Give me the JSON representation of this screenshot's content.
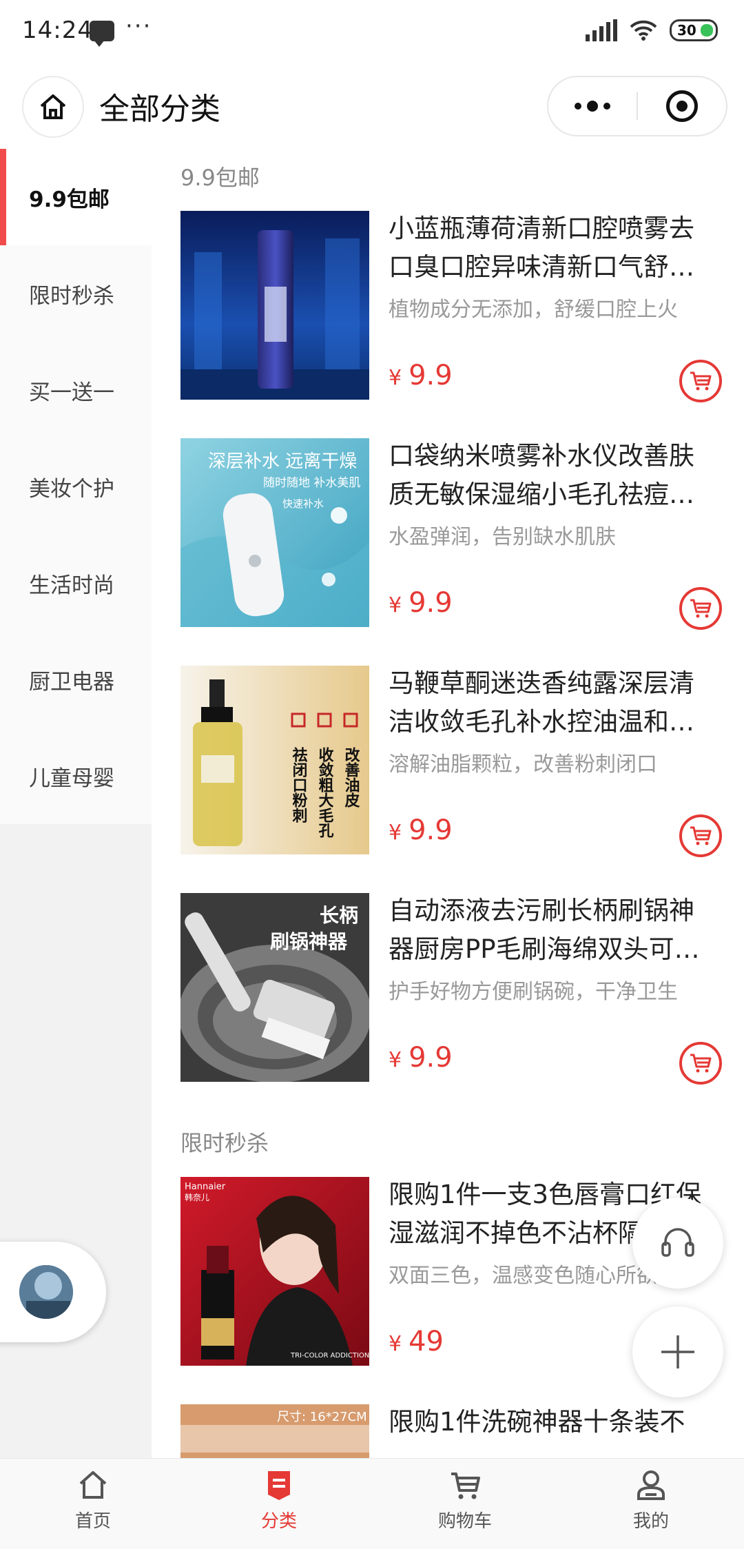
{
  "status_bar": {
    "time": "14:24",
    "dots": "···",
    "battery": "30"
  },
  "header": {
    "title": "全部分类"
  },
  "sidebar": {
    "items": [
      {
        "label": "9.9包邮",
        "active": true
      },
      {
        "label": "限时秒杀",
        "active": false
      },
      {
        "label": "买一送一",
        "active": false
      },
      {
        "label": "美妆个护",
        "active": false
      },
      {
        "label": "生活时尚",
        "active": false
      },
      {
        "label": "厨卫电器",
        "active": false
      },
      {
        "label": "儿童母婴",
        "active": false
      }
    ]
  },
  "sections": [
    {
      "title": "9.9包邮",
      "products": [
        {
          "title": "小蓝瓶薄荷清新口腔喷雾去口臭口腔异味清新口气舒…",
          "desc": "植物成分无添加，舒缓口腔上火",
          "currency": "¥",
          "price": "9.9"
        },
        {
          "title": "口袋纳米喷雾补水仪改善肤质无敏保湿缩小毛孔祛痘…",
          "desc": "水盈弹润，告别缺水肌肤",
          "currency": "¥",
          "price": "9.9"
        },
        {
          "title": "马鞭草酮迷迭香纯露深层清洁收敛毛孔补水控油温和…",
          "desc": "溶解油脂颗粒，改善粉刺闭口",
          "currency": "¥",
          "price": "9.9"
        },
        {
          "title": "自动添液去污刷长柄刷锅神器厨房PP毛刷海绵双头可…",
          "desc": "护手好物方便刷锅碗，干净卫生",
          "currency": "¥",
          "price": "9.9"
        }
      ]
    },
    {
      "title": "限时秒杀",
      "products": [
        {
          "title": "限购1件一支3色唇膏口红保湿滋润不掉色不沾杯隔…",
          "desc": "双面三色，温感变色随心所欲",
          "currency": "¥",
          "price": "49"
        },
        {
          "title": "限购1件洗碗神器十条装不",
          "desc": "",
          "currency": "¥",
          "price": ""
        }
      ]
    }
  ],
  "image_text": {
    "p2_line1": "深层补水 远离干燥",
    "p2_line2": "随时随地 补水美肌",
    "p2_badge": "快速补水",
    "p3_col1": "改善油皮",
    "p3_col2": "收敛粗大毛孔",
    "p3_col3": "祛闭口粉刺",
    "p4_line1": "长柄",
    "p4_line2": "刷锅神器",
    "p5_brand": "Hannaier",
    "p5_brand_cn": "韩奈儿",
    "p5_tag": "TRI-COLOR ADDICTION",
    "p6_size": "尺寸: 16*27CM"
  },
  "tabbar": {
    "items": [
      {
        "label": "首页",
        "icon": "home-icon",
        "active": false
      },
      {
        "label": "分类",
        "icon": "category-icon",
        "active": true
      },
      {
        "label": "购物车",
        "icon": "cart-icon",
        "active": false
      },
      {
        "label": "我的",
        "icon": "profile-icon",
        "active": false
      }
    ]
  },
  "colors": {
    "accent": "#e53935",
    "sidebar_active_bar": "#f24b4b"
  }
}
